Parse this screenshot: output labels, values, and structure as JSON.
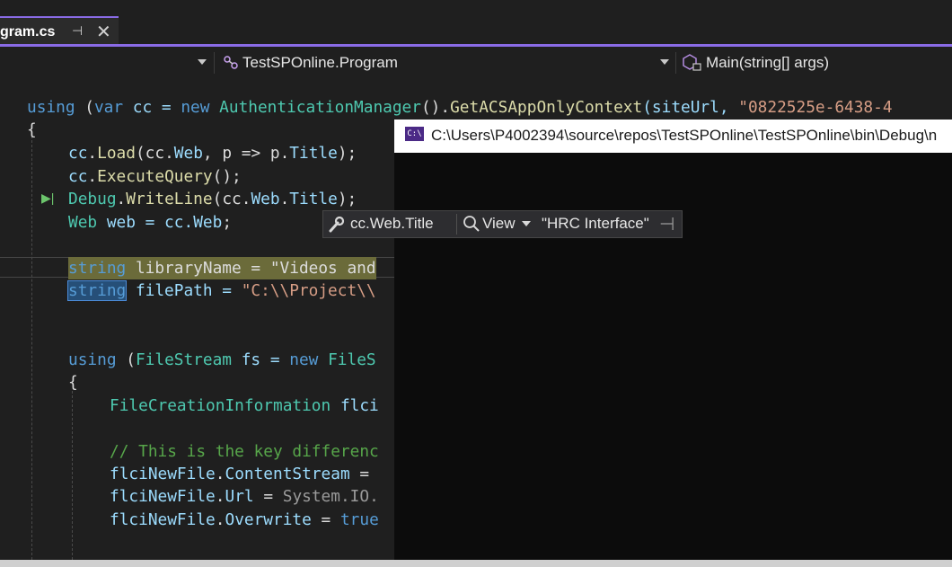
{
  "tab": {
    "name": "gram.cs",
    "pin_glyph": "⊣",
    "close_glyph": "✕"
  },
  "nav": {
    "class_label": "TestSPOnline.Program",
    "method_label": "Main(string[] args)"
  },
  "code": {
    "l1": {
      "a": "using",
      "b": " (",
      "c": "var",
      "d": " cc = ",
      "e": "new",
      "f": " ",
      "g": "AuthenticationManager",
      "h": "().",
      "i": "GetACSAppOnlyContext",
      "j": "(siteUrl, ",
      "k": "\"0822525e-6438-4"
    },
    "l2": "{",
    "l3": {
      "a": "cc",
      "b": ".",
      "c": "Load",
      "d": "(cc.",
      "e": "Web",
      "f": ", p => p.",
      "g": "Title",
      "h": ");"
    },
    "l4": {
      "a": "cc",
      "b": ".",
      "c": "ExecuteQuery",
      "d": "();"
    },
    "l5": {
      "a": "Debug",
      "b": ".",
      "c": "WriteLine",
      "d": "(cc.",
      "e": "Web",
      "f": ".",
      "g": "Title",
      "h": ");"
    },
    "l6": {
      "a": "Web",
      "b": " web = cc.",
      "c": "Web",
      "d": ";"
    },
    "l8": {
      "a": "string",
      "b": " libraryName = ",
      "c": "\"Videos and"
    },
    "l9": {
      "a": "string",
      "b": " filePath = ",
      "c": "\"C:\\\\Project\\\\"
    },
    "l12": {
      "a": "using",
      "b": " (",
      "c": "FileStream",
      "d": " fs = ",
      "e": "new",
      "f": " ",
      "g": "FileS"
    },
    "l13": "{",
    "l14": {
      "a": "FileCreationInformation",
      "b": " flci"
    },
    "l16": "// This is the key differenc",
    "l17": {
      "a": "flciNewFile",
      "b": ".",
      "c": "ContentStream",
      "d": " ="
    },
    "l18": {
      "a": "flciNewFile",
      "b": ".",
      "c": "Url",
      "d": " = ",
      "e": "System.IO."
    },
    "l19": {
      "a": "flciNewFile",
      "b": ".",
      "c": "Overwrite",
      "d": " = ",
      "e": "true"
    }
  },
  "console": {
    "icon_text": "C:\\",
    "title": "C:\\Users\\P4002394\\source\\repos\\TestSPOnline\\TestSPOnline\\bin\\Debug\\n"
  },
  "datatip": {
    "expression": "cc.Web.Title",
    "view_label": "View",
    "value": "\"HRC Interface\"",
    "pin_glyph": "⊣"
  },
  "colors": {
    "accent": "#8a6be6",
    "keyword": "#569cd6",
    "type": "#4ec9b0",
    "method": "#dcdcaa",
    "string": "#d69d85",
    "comment": "#57a64a"
  }
}
